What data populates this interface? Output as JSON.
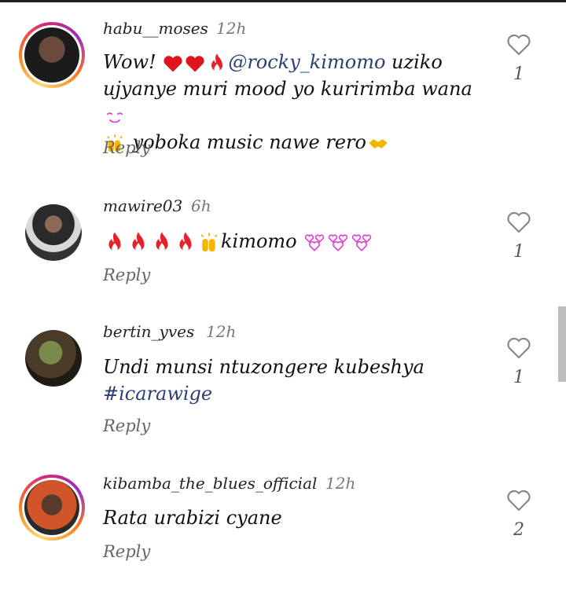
{
  "comments": [
    {
      "username": "habu__moses",
      "time": "12h",
      "text_a": "Wow! ",
      "mention": "@rocky_kimomo",
      "text_b": " uziko ujyanye muri mood yo kuririmba wana",
      "text_c": " yoboka music nawe rero",
      "likes": "1",
      "reply": "Reply"
    },
    {
      "username": "mawire03",
      "time": "6h",
      "text_a": "kimomo ",
      "likes": "1",
      "reply": "Reply"
    },
    {
      "username": "bertin_yves",
      "time": "12h",
      "text_a": "Undi munsi ntuzongere kubeshya ",
      "hashtag": "#icarawige",
      "likes": "1",
      "reply": "Reply"
    },
    {
      "username": "kibamba_the_blues_official",
      "time": "12h",
      "text_a": "Rata urabizi cyane",
      "likes": "2",
      "reply": "Reply"
    }
  ],
  "colors": {
    "mention": "#2b3f74",
    "fire": "#e8202a",
    "heart_red": "#e0141e",
    "pink": "#e23fd6"
  }
}
